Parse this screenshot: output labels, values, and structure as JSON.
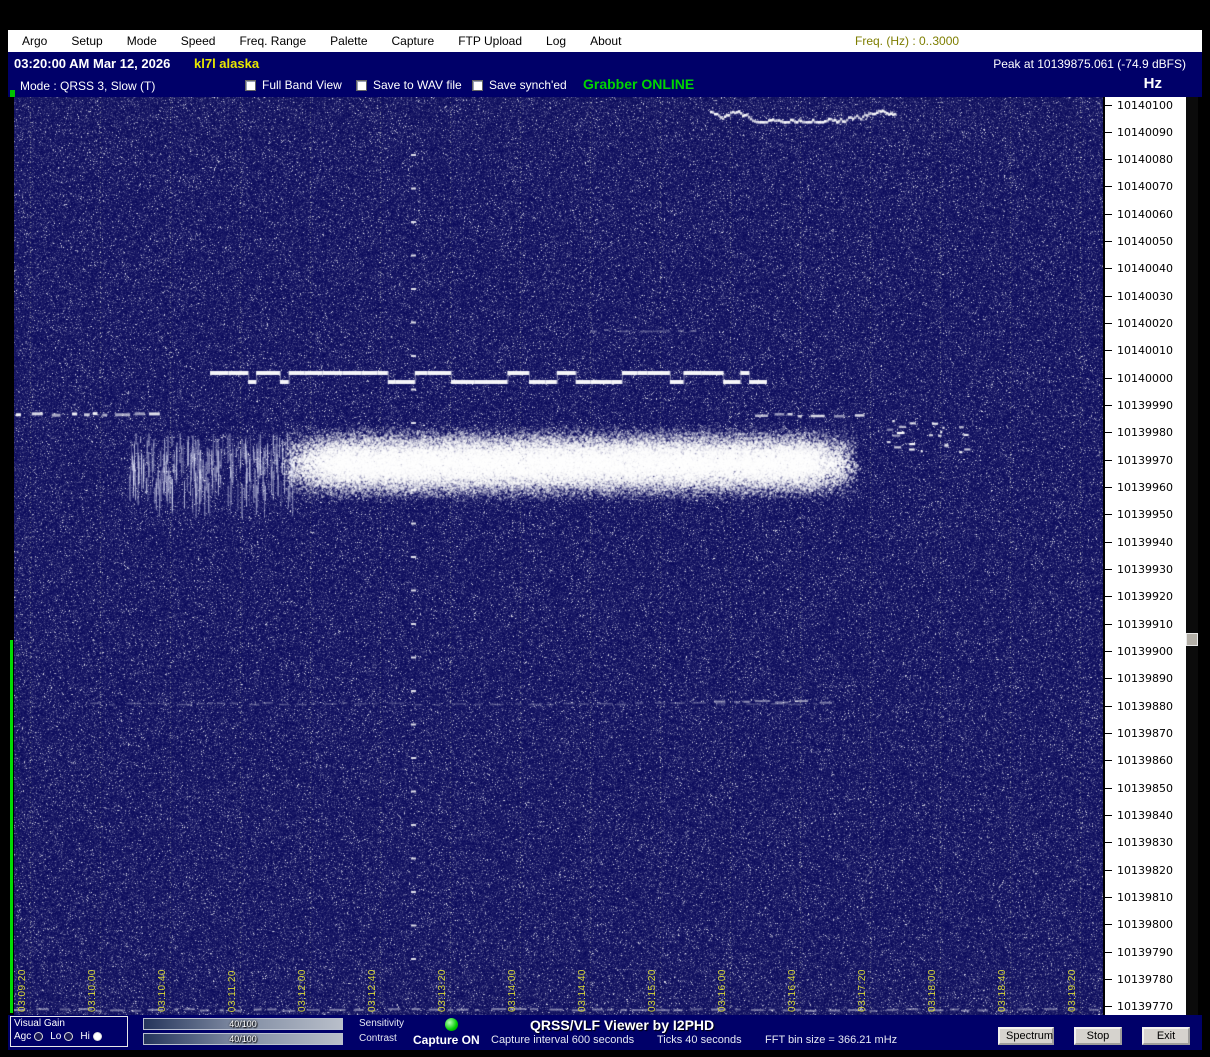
{
  "colors": {
    "header_bg": "#000069",
    "menu_bg": "#ffffff",
    "status_green": "#00d400",
    "callsign_yellow": "#e8e800",
    "time_label_yellow": "#d8d838",
    "spectrogram_base_blue": "#0f0f6e",
    "button_face": "#d6d3ce"
  },
  "menu": {
    "items": [
      "Argo",
      "Setup",
      "Mode",
      "Speed",
      "Freq. Range",
      "Palette",
      "Capture",
      "FTP Upload",
      "Log",
      "About"
    ],
    "freq_range": "Freq. (Hz) :  0..3000"
  },
  "header": {
    "timestamp": "03:20:00 AM  Mar 12, 2026",
    "callsign": "kl7l alaska",
    "peak": "Peak at 10139875.061 (-74.9 dBFS)",
    "mode": "Mode : QRSS 3, Slow  (T)",
    "checkboxes": [
      {
        "label": "Full Band View",
        "checked": false
      },
      {
        "label": "Save to WAV file",
        "checked": false
      },
      {
        "label": "Save synch'ed",
        "checked": false
      }
    ],
    "grabber_status": "Grabber ONLINE",
    "unit": "Hz"
  },
  "spectrogram": {
    "time_labels": [
      "03:09:20",
      "03:10:00",
      "03:10:40",
      "03:11:20",
      "03:12:00",
      "03:12:40",
      "03:13:20",
      "03:14:00",
      "03:14:40",
      "03:15:20",
      "03:16:00",
      "03:16:40",
      "03:17:20",
      "03:18:00",
      "03:18:40",
      "03:19:20"
    ],
    "freq_labels": [
      "10140100",
      "10140090",
      "10140080",
      "10140070",
      "10140060",
      "10140050",
      "10140040",
      "10140030",
      "10140020",
      "10140010",
      "10140000",
      "10139990",
      "10139980",
      "10139970",
      "10139960",
      "10139950",
      "10139940",
      "10139930",
      "10139920",
      "10139910",
      "10139900",
      "10139890",
      "10139880",
      "10139870",
      "10139860",
      "10139850",
      "10139840",
      "10139830",
      "10139820",
      "10139810",
      "10139800",
      "10139790",
      "10139780",
      "10139770"
    ]
  },
  "statusbar": {
    "visual_gain": {
      "title": "Visual Gain",
      "radios": [
        {
          "label": "Agc",
          "selected": false
        },
        {
          "label": "Lo",
          "selected": false
        },
        {
          "label": "Hi",
          "selected": true
        }
      ]
    },
    "sliders": [
      {
        "value": "40/100",
        "label": "Sensitivity"
      },
      {
        "value": "40/100",
        "label": "Contrast"
      }
    ],
    "capture_status": "Capture ON",
    "capture_interval": "Capture interval 600 seconds",
    "app_title": "QRSS/VLF Viewer by I2PHD",
    "ticks_label": "Ticks  40 seconds",
    "fft_label": "FFT bin size = 366.21 mHz",
    "buttons": [
      {
        "label": "Spectrum"
      },
      {
        "label": "Stop"
      },
      {
        "label": "Exit"
      }
    ]
  }
}
